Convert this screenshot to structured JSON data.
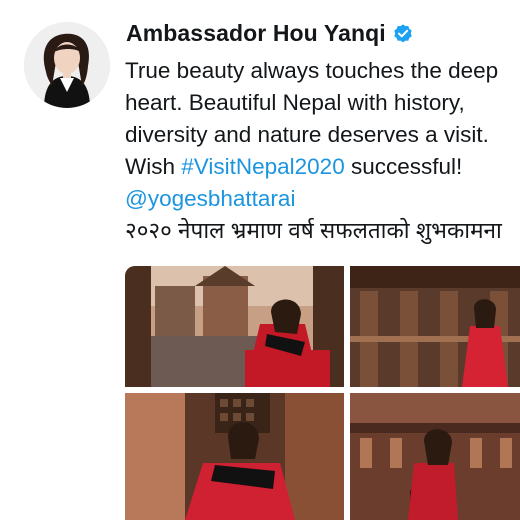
{
  "tweet": {
    "display_name": "Ambassador Hou Yanqi",
    "verified": true,
    "text_lines": {
      "l1": "True beauty always touches the deep",
      "l2": "heart.  Beautiful Nepal with history,",
      "l3": "diversity and nature deserves a visit.",
      "l4_prefix": "Wish ",
      "hashtag": "#VisitNepal2020",
      "l4_suffix": " successful!",
      "mention": "@yogesbhattarai",
      "l6": "२०२० नेपाल भ्रमाण वर्ष सफलताको शुभकामना"
    },
    "colors": {
      "link": "#1b95e0",
      "verified_badge": "#1da1f2",
      "text": "#14171a"
    }
  },
  "icons": {
    "verified": "verified-badge-icon"
  },
  "media": {
    "photo_count": 4
  }
}
